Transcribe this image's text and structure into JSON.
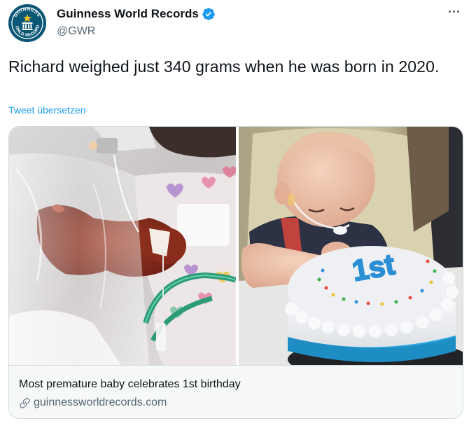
{
  "account": {
    "display_name": "Guinness World Records",
    "handle": "@GWR",
    "verified_icon": "verified-badge-icon",
    "avatar_icon": "guinness-world-records-logo",
    "avatar_text": "GUINNESS WORLD RECORDS",
    "brand_color": "#0b5876",
    "verified_color": "#1d9bf0"
  },
  "more_icon": "more-dots-icon",
  "tweet": {
    "text": "Richard weighed just 340 grams when he was born in 2020.",
    "translate_label": "Tweet übersetzen"
  },
  "card": {
    "title": "Most premature baby celebrates 1st birthday",
    "url": "guinnessworldrecords.com",
    "link_icon": "link-icon",
    "images": [
      {
        "name": "premature-baby-incubator-photo"
      },
      {
        "name": "baby-birthday-cake-photo"
      }
    ],
    "cake_text": "1st"
  }
}
